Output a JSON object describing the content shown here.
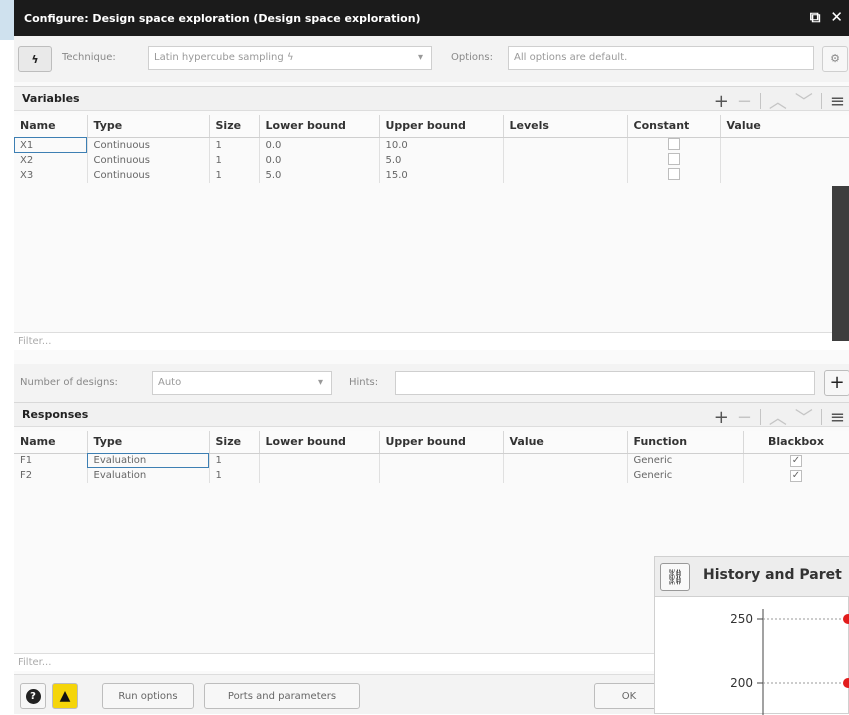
{
  "window": {
    "title": "Configure: Design space exploration (Design space exploration)"
  },
  "toolbar": {
    "technique_label": "Technique:",
    "technique_value": "Latin hypercube sampling",
    "options_label": "Options:",
    "options_value": "All options are default."
  },
  "variables": {
    "title": "Variables",
    "columns": [
      "Name",
      "Type",
      "Size",
      "Lower bound",
      "Upper bound",
      "Levels",
      "Constant",
      "Value"
    ],
    "rows": [
      {
        "name": "X1",
        "type": "Continuous",
        "size": "1",
        "lower": "0.0",
        "upper": "10.0",
        "levels": "",
        "value": ""
      },
      {
        "name": "X2",
        "type": "Continuous",
        "size": "1",
        "lower": "0.0",
        "upper": "5.0",
        "levels": "",
        "value": ""
      },
      {
        "name": "X3",
        "type": "Continuous",
        "size": "1",
        "lower": "5.0",
        "upper": "15.0",
        "levels": "",
        "value": ""
      }
    ],
    "filter_placeholder": "Filter..."
  },
  "designs": {
    "number_label": "Number of designs:",
    "number_value": "Auto",
    "hints_label": "Hints:"
  },
  "responses": {
    "title": "Responses",
    "columns": [
      "Name",
      "Type",
      "Size",
      "Lower bound",
      "Upper bound",
      "Value",
      "Function",
      "Blackbox"
    ],
    "rows": [
      {
        "name": "F1",
        "type": "Evaluation",
        "size": "1",
        "lower": "",
        "upper": "",
        "value": "",
        "function": "Generic"
      },
      {
        "name": "F2",
        "type": "Evaluation",
        "size": "1",
        "lower": "",
        "upper": "",
        "value": "",
        "function": "Generic"
      }
    ],
    "filter_placeholder": "Filter..."
  },
  "buttons": {
    "run_options": "Run options",
    "ports_parameters": "Ports and parameters",
    "ok": "OK"
  },
  "history_panel": {
    "title": "History and Paret",
    "tick_250": "250",
    "tick_200": "200"
  },
  "colors": {
    "titlebar": "#1b1b1b",
    "selection": "#3d7fb3",
    "warning": "#f5d50a",
    "point": "#e21c1c"
  }
}
